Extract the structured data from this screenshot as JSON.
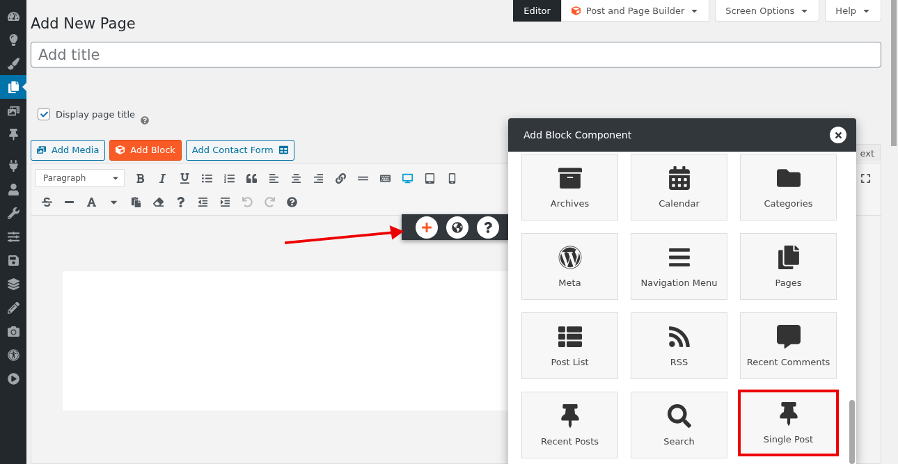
{
  "sidebar": {
    "items": [
      {
        "selected": false
      },
      {
        "selected": false
      },
      {
        "selected": false
      },
      {
        "selected": true
      },
      {
        "selected": false
      },
      {
        "selected": false
      },
      {
        "selected": false
      },
      {
        "selected": false
      },
      {
        "selected": false
      },
      {
        "selected": false
      },
      {
        "selected": false
      },
      {
        "selected": false
      },
      {
        "selected": false
      },
      {
        "selected": false
      },
      {
        "selected": false
      },
      {
        "selected": false
      }
    ]
  },
  "header_tabs": [
    {
      "label": "Editor",
      "selected": true
    },
    {
      "label": "Post and Page Builder",
      "selected": false
    }
  ],
  "header_buttons": [
    "Screen Options",
    "Help"
  ],
  "page_title": "Add New Page",
  "title_field": {
    "placeholder": "Add title"
  },
  "display_title": {
    "label": "Display page title",
    "checked": true
  },
  "media_buttons": [
    {
      "kind": "media",
      "label": "Add Media"
    },
    {
      "kind": "block",
      "label": "Add Block"
    },
    {
      "kind": "form",
      "label": "Add Contact Form"
    }
  ],
  "editor_tab": "ext",
  "format_select": "Paragraph",
  "preview_devices": [
    {
      "selected": true
    },
    {
      "selected": false
    },
    {
      "selected": false
    }
  ],
  "modal": {
    "title": "Add Block Component",
    "tiles": [
      {
        "kind": "archive",
        "label": "Archives",
        "selected": false
      },
      {
        "kind": "calendar",
        "label": "Calendar",
        "selected": false
      },
      {
        "kind": "folder",
        "label": "Categories",
        "selected": false
      },
      {
        "kind": "wordpress",
        "label": "Meta",
        "selected": false
      },
      {
        "kind": "menu",
        "label": "Navigation Menu",
        "selected": false
      },
      {
        "kind": "pages",
        "label": "Pages",
        "selected": false
      },
      {
        "kind": "list",
        "label": "Post List",
        "selected": false
      },
      {
        "kind": "rss",
        "label": "RSS",
        "selected": false
      },
      {
        "kind": "comment",
        "label": "Recent Comments",
        "selected": false
      },
      {
        "kind": "pin",
        "label": "Recent Posts",
        "selected": false
      },
      {
        "kind": "search",
        "label": "Search",
        "selected": false
      },
      {
        "kind": "pin",
        "label": "Single Post",
        "selected": true
      }
    ]
  }
}
